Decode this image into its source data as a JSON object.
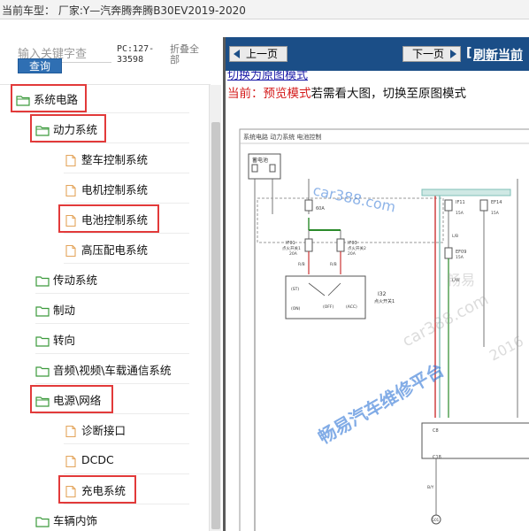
{
  "topbar": {
    "vehicle_text": "当前车型：  厂家:Y—汽奔腾奔腾B30EV2019-2020"
  },
  "search": {
    "placeholder": "输入关键字查",
    "button_label": "查询"
  },
  "pc_code": "PC:127-33598",
  "collapse_all_label": "折叠全部",
  "tree": [
    {
      "label": "系统电路",
      "icon": "folder-open-icon",
      "highlighted": true
    },
    {
      "label": "动力系统",
      "icon": "folder-open-icon",
      "highlighted": true
    },
    {
      "label": "整车控制系统",
      "icon": "document-icon",
      "highlighted": false
    },
    {
      "label": "电机控制系统",
      "icon": "document-icon",
      "highlighted": false
    },
    {
      "label": "电池控制系统",
      "icon": "document-icon",
      "highlighted": true
    },
    {
      "label": "高压配电系统",
      "icon": "document-icon",
      "highlighted": false
    },
    {
      "label": "传动系统",
      "icon": "folder-closed-icon",
      "highlighted": false
    },
    {
      "label": "制动",
      "icon": "folder-closed-icon",
      "highlighted": false
    },
    {
      "label": "转向",
      "icon": "folder-closed-icon",
      "highlighted": false
    },
    {
      "label": "音频\\视频\\车载通信系统",
      "icon": "folder-closed-icon",
      "highlighted": false
    },
    {
      "label": "电源\\网络",
      "icon": "folder-open-icon",
      "highlighted": true
    },
    {
      "label": "诊断接口",
      "icon": "document-icon",
      "highlighted": false
    },
    {
      "label": "DCDC",
      "icon": "document-icon",
      "highlighted": false
    },
    {
      "label": "充电系统",
      "icon": "document-icon",
      "highlighted": true
    },
    {
      "label": "车辆内饰",
      "icon": "folder-closed-icon",
      "highlighted": false
    }
  ],
  "viewer": {
    "prev_label": "上一页",
    "next_label": "下一页",
    "refresh_label": "刷新当前",
    "switch_link": "切换为原图模式",
    "mode_prefix": "当前：预览模式",
    "mode_suffix": "若需看大图，切换至原图模式"
  },
  "diagram": {
    "header": "系统电路  动力系统  电池控制",
    "battery_label": "蓄电池",
    "main_fuse": "60A",
    "fuse_if01": "IF01",
    "fuse_if01_desc": "点火开关1",
    "fuse_if01_amp": "20A",
    "fuse_if03": "IF03",
    "fuse_if03_desc": "点火开关2",
    "fuse_if03_amp": "20A",
    "fuse_if11": "IF11",
    "fuse_if11_amp": "15A",
    "fuse_ef14": "EF14",
    "fuse_ef14_amp": "15A",
    "fuse_ef09": "EF09",
    "fuse_ef09_amp": "15A",
    "switch_label": "I32",
    "switch_desc": "点火开关1",
    "switch_pins": [
      "(ST)",
      "(ON)",
      "(OFF)",
      "(ACC)"
    ],
    "connector_labels": [
      "C8",
      "C18",
      "C18",
      "G01"
    ],
    "wire_labels": [
      "R/B",
      "R/B",
      "L/B",
      "L/W",
      "B/Y"
    ]
  },
  "watermark": {
    "line1": "car388.com",
    "line2": "畅易",
    "line3": "car388.com",
    "line4": "畅易汽车维修平台",
    "line5": "2016"
  },
  "colors": {
    "toolbar_blue": "#1b4e87",
    "search_blue": "#2f6fb3",
    "highlight_red": "#e23a3a",
    "preview_red": "#d41a1a",
    "folder_green": "#4caf50",
    "doc_orange": "#e3a45b",
    "watermark_blue": "#2f75d6"
  }
}
